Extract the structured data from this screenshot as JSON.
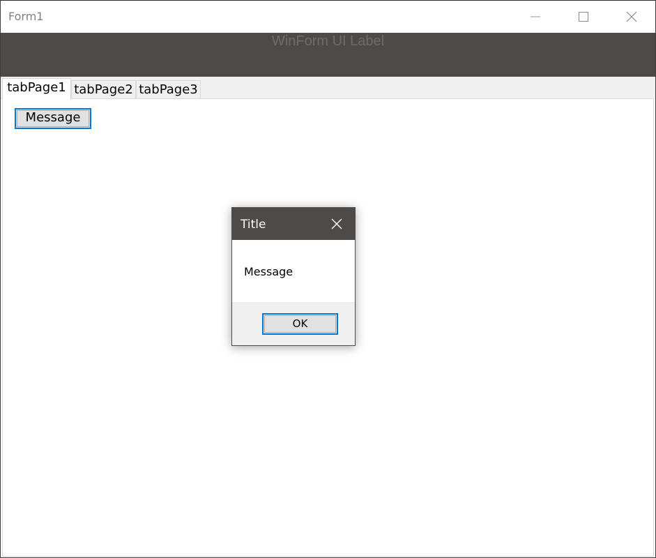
{
  "window": {
    "title": "Form1",
    "minimize_icon": "minimize-icon",
    "maximize_icon": "maximize-icon",
    "close_icon": "close-icon"
  },
  "header": {
    "label": "WinForm UI Label",
    "background_color": "#4d4a47",
    "text_color": "#6e6b68"
  },
  "tabs": [
    {
      "label": "tabPage1",
      "selected": true
    },
    {
      "label": "tabPage2",
      "selected": false
    },
    {
      "label": "tabPage3",
      "selected": false
    }
  ],
  "tab_page": {
    "message_button_label": "Message"
  },
  "dialog": {
    "title": "Title",
    "close_icon": "close-icon",
    "message": "Message",
    "ok_label": "OK",
    "accent_color": "#0078d7"
  }
}
